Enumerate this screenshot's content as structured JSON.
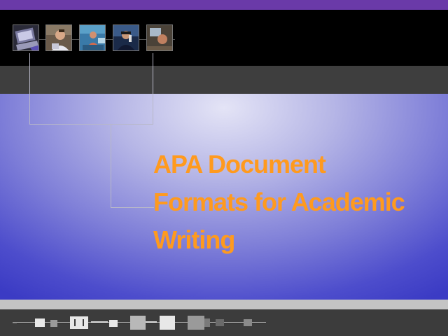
{
  "slide": {
    "title_lines": [
      "APA Document",
      "Formats for Academic",
      "Writing"
    ]
  },
  "colors": {
    "title": "#ff9a1e",
    "top_accent": "#6a3aa8",
    "header": "#000000",
    "band": "#3e3e3e",
    "panel_center": "#e4e4f6",
    "panel_edge": "#3b3bc4",
    "footer_light": "#c4c4c4",
    "footer_dark": "#3c3c3c"
  },
  "header": {
    "thumbnails": [
      {
        "icon": "laptop-photo-icon"
      },
      {
        "icon": "person-photo-icon"
      },
      {
        "icon": "workstation-photo-icon"
      },
      {
        "icon": "phone-call-photo-icon"
      },
      {
        "icon": "office-photo-icon"
      }
    ]
  }
}
